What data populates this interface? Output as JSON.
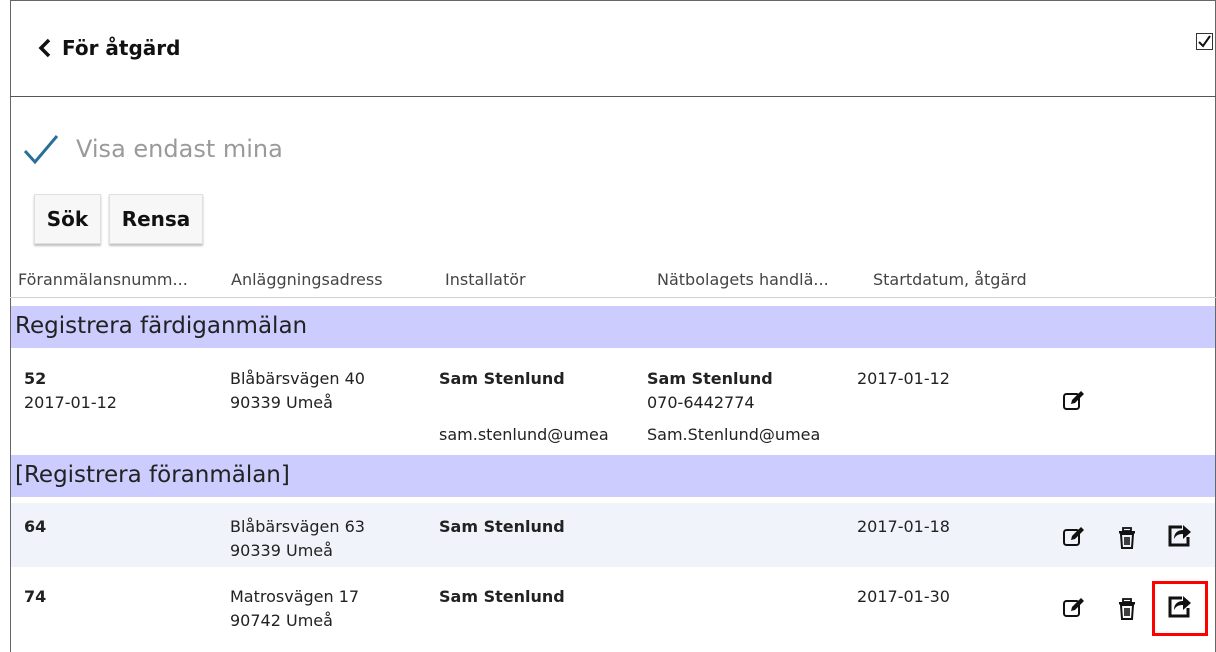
{
  "header": {
    "back_label": "För åtgärd"
  },
  "filter": {
    "label": "Visa endast mina"
  },
  "buttons": {
    "search": "Sök",
    "clear": "Rensa"
  },
  "columns": [
    "Föranmälansnumm...",
    "Anläggningsadress",
    "Installatör",
    "Nätbolagets handlä...",
    "Startdatum, åtgärd"
  ],
  "groups": [
    {
      "title": "Registrera färdiganmälan",
      "rows": [
        {
          "id": "52",
          "date": "2017-01-12",
          "addr1": "Blåbärsvägen 40",
          "addr2": "90339 Umeå",
          "installer": "Sam Stenlund",
          "installer_email": "sam.stenlund@umea",
          "handler": "Sam Stenlund",
          "handler_phone": "070-6442774",
          "handler_email": "Sam.Stenlund@umea",
          "start": "2017-01-12"
        }
      ]
    },
    {
      "title": "[Registrera föranmälan]",
      "rows": [
        {
          "id": "64",
          "addr1": "Blåbärsvägen 63",
          "addr2": "90339 Umeå",
          "installer": "Sam Stenlund",
          "start": "2017-01-18"
        },
        {
          "id": "74",
          "addr1": "Matrosvägen 17",
          "addr2": "90742 Umeå",
          "installer": "Sam Stenlund",
          "start": "2017-01-30"
        }
      ]
    }
  ],
  "icons": {
    "edit": "edit-icon",
    "delete": "trash-icon",
    "forward": "forward-icon",
    "back": "chevron-left-icon",
    "check": "checkmark-icon"
  },
  "colors": {
    "group_bg": "#ccccff",
    "check": "#2a6f97",
    "highlight": "#ff0000"
  }
}
